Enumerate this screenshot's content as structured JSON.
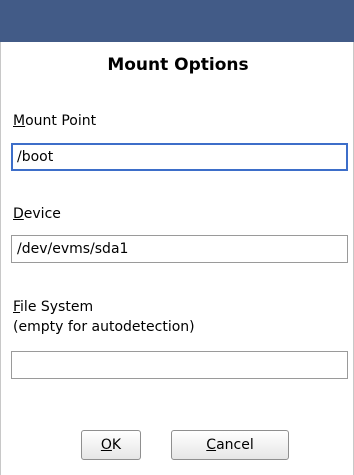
{
  "dialog": {
    "title": "Mount Options",
    "mount_point": {
      "label_mnemonic": "M",
      "label_rest": "ount Point",
      "value": "/boot"
    },
    "device": {
      "label_mnemonic": "D",
      "label_rest": "evice",
      "value": "/dev/evms/sda1"
    },
    "file_system": {
      "label_mnemonic": "F",
      "label_rest": "ile System",
      "label_line2": "(empty for autodetection)",
      "value": ""
    },
    "buttons": {
      "ok_mnemonic": "O",
      "ok_rest": "K",
      "cancel_mnemonic": "C",
      "cancel_rest": "ancel"
    }
  },
  "colors": {
    "titlebar": "#425b87",
    "focus_border": "#3d6ec9"
  }
}
